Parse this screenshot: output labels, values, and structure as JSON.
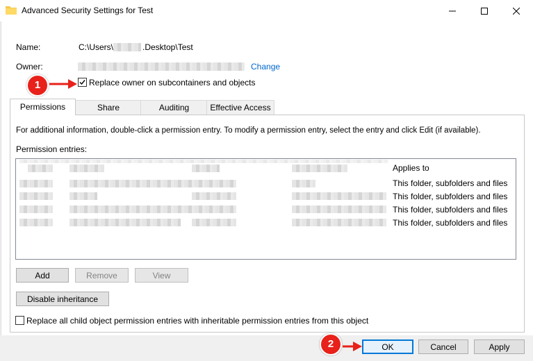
{
  "window": {
    "title": "Advanced Security Settings for Test",
    "accent_color": "#0078d7"
  },
  "fields": {
    "name_label": "Name:",
    "name_value_prefix": "C:\\Users\\",
    "name_value_suffix": ".Desktop\\Test",
    "owner_label": "Owner:",
    "change_link": "Change",
    "replace_owner_label": "Replace owner on subcontainers and objects",
    "replace_owner_checked": true
  },
  "tabs": [
    {
      "label": "Permissions",
      "active": true
    },
    {
      "label": "Share",
      "active": false
    },
    {
      "label": "Auditing",
      "active": false
    },
    {
      "label": "Effective Access",
      "active": false
    }
  ],
  "permissions": {
    "info_text": "For additional information, double-click a permission entry. To modify a permission entry, select the entry and click Edit (if available).",
    "entries_label": "Permission entries:",
    "applies_to_header": "Applies to",
    "rows": [
      {
        "applies_to": "This folder, subfolders and files"
      },
      {
        "applies_to": "This folder, subfolders and files"
      },
      {
        "applies_to": "This folder, subfolders and files"
      },
      {
        "applies_to": "This folder, subfolders and files"
      }
    ]
  },
  "buttons": {
    "add": "Add",
    "remove": "Remove",
    "view": "View",
    "disable_inheritance": "Disable inheritance",
    "ok": "OK",
    "cancel": "Cancel",
    "apply": "Apply"
  },
  "replace_child_label": "Replace all child object permission entries with inheritable permission entries from this object",
  "replace_child_checked": false,
  "annotations": {
    "step1": "1",
    "step2": "2",
    "color": "#e8211a"
  }
}
